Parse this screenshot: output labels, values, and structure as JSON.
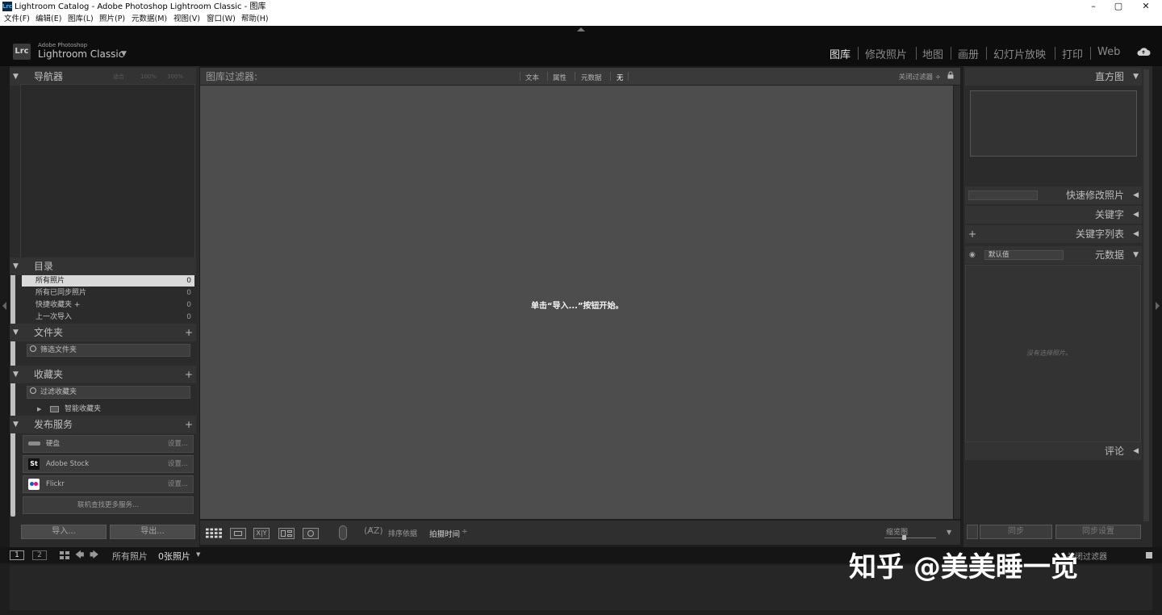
{
  "window": {
    "title": "Lightroom Catalog - Adobe Photoshop Lightroom Classic - 图库",
    "app_badge": "Lrc",
    "controls": [
      "–",
      "▢",
      "✕"
    ]
  },
  "menu": [
    "文件(F)",
    "编辑(E)",
    "图库(L)",
    "照片(P)",
    "元数据(M)",
    "视图(V)",
    "窗口(W)",
    "帮助(H)"
  ],
  "identity": {
    "logo": "Lrc",
    "brand_small": "Adobe Photoshop",
    "brand_big": "Lightroom Classic",
    "caret": "▼"
  },
  "modules": [
    "图库",
    "修改照片",
    "地图",
    "画册",
    "幻灯片放映",
    "打印",
    "Web"
  ],
  "left_panel": {
    "navigator": {
      "title": "导航器",
      "options": [
        "适合",
        "100%",
        "300%"
      ]
    },
    "catalog": {
      "title": "目录",
      "items": [
        {
          "name": "所有照片",
          "count": "0"
        },
        {
          "name": "所有已同步照片",
          "count": "0"
        },
        {
          "name": "快捷收藏夹 +",
          "count": "0"
        },
        {
          "name": "上一次导入",
          "count": "0"
        }
      ]
    },
    "folders": {
      "title": "文件夹",
      "plus": "+",
      "search_placeholder": "筛选文件夹"
    },
    "collections": {
      "title": "收藏夹",
      "plus": "+",
      "search_placeholder": "过滤收藏夹",
      "smart_label": "智能收藏夹"
    },
    "publish": {
      "title": "发布服务",
      "plus": "+",
      "services": [
        {
          "name": "硬盘",
          "settings": "设置..."
        },
        {
          "name": "Adobe Stock",
          "settings": "设置..."
        },
        {
          "name": "Flickr",
          "settings": "设置..."
        }
      ],
      "find_more": "联机查找更多服务..."
    },
    "import_label": "导入...",
    "export_label": "导出..."
  },
  "filter_bar": {
    "label": "图库过滤器:",
    "tabs": [
      "文本",
      "属性",
      "元数据",
      "无"
    ],
    "active_tab": "无",
    "off_label": "关闭过滤器 ÷"
  },
  "grid": {
    "empty_message": "单击“导入...”按钮开始。"
  },
  "toolbar": {
    "sort_label": "排序依据",
    "sort_value": "拍摄时间",
    "sort_caret": "÷",
    "thumb_label": "缩览图",
    "menu_caret": "▼"
  },
  "right_panel": {
    "histogram": "直方图",
    "quick_develop": "快速修改照片",
    "keywording": "关键字",
    "keyword_list": "关键字列表",
    "metadata": "元数据",
    "metadata_preset": "默认值",
    "no_photo": "没有选择照片。",
    "comments": "评论",
    "sync_label": "同步",
    "sync_settings_label": "同步设置"
  },
  "filmstrip": {
    "view1": "1",
    "view2": "2",
    "source": "所有照片",
    "count": "0张照片",
    "caret": "▼",
    "filter_label": "关闭过滤器"
  },
  "watermark": "知乎 @美美睡一觉",
  "colors": {
    "panel_bg": "#2b2b2b",
    "header_bg": "#0d0d0d",
    "grid_bg": "#4d4d4d",
    "active_module": "#e6e6e6",
    "inactive_module": "#8a8a8a"
  }
}
